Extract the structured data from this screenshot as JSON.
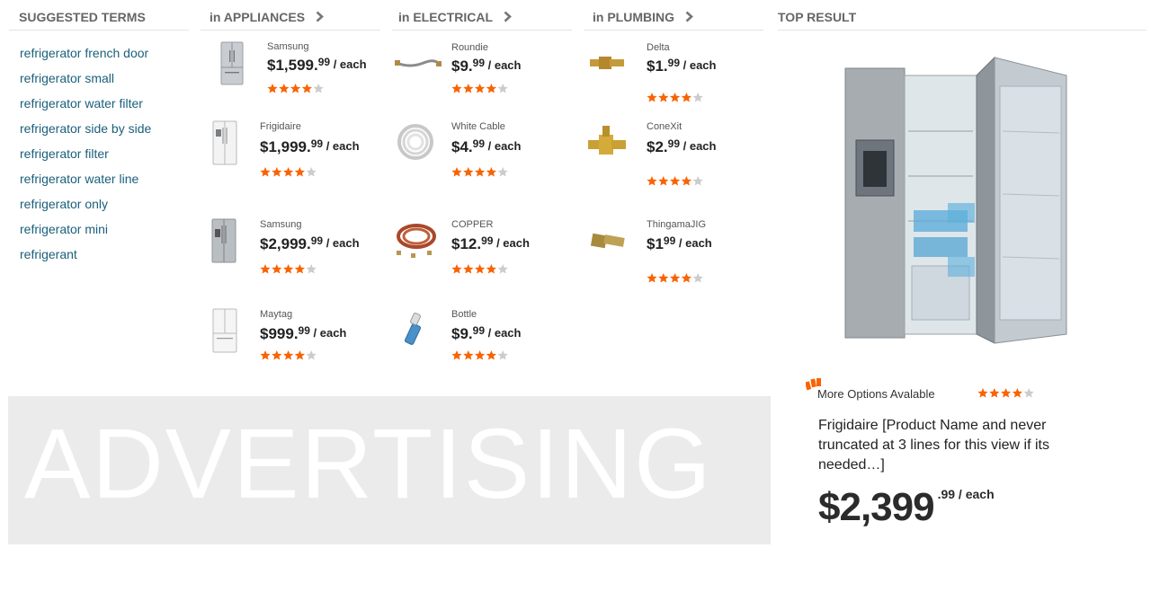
{
  "suggested": {
    "header": "SUGGESTED TERMS",
    "terms": [
      "refrigerator french door",
      "refrigerator small",
      "refrigerator water filter",
      "refrigerator side by side",
      "refrigerator filter",
      "refrigerator water line",
      "refrigerator only",
      "refrigerator mini",
      "refrigerant"
    ]
  },
  "appliances": {
    "header": "in APPLIANCES",
    "products": [
      {
        "brand": "Samsung",
        "dollars": "$1,599.",
        "cents": "99",
        "each": " / each",
        "rating": 4
      },
      {
        "brand": "Frigidaire",
        "dollars": "$1,999.",
        "cents": "99",
        "each": " / each",
        "rating": 4
      },
      {
        "brand": "Samsung",
        "dollars": "$2,999.",
        "cents": "99",
        "each": " / each",
        "rating": 4
      },
      {
        "brand": "Maytag",
        "dollars": "$999.",
        "cents": "99",
        "each": " / each",
        "rating": 4
      }
    ]
  },
  "electrical": {
    "header": "in ELECTRICAL",
    "products": [
      {
        "brand": "Roundie",
        "dollars": "$9.",
        "cents": "99",
        "each": " / each",
        "rating": 4
      },
      {
        "brand": "White Cable",
        "dollars": "$4.",
        "cents": "99",
        "each": " / each",
        "rating": 4
      },
      {
        "brand": "COPPER",
        "dollars": "$12.",
        "cents": "99",
        "each": " / each",
        "rating": 4
      },
      {
        "brand": "Bottle",
        "dollars": "$9.",
        "cents": "99",
        "each": " / each",
        "rating": 4
      }
    ]
  },
  "plumbing": {
    "header": "in PLUMBING",
    "products": [
      {
        "brand": "Delta",
        "dollars": "$1.",
        "cents": "99",
        "each": " / each",
        "rating": 4
      },
      {
        "brand": "ConeXit",
        "dollars": "$2.",
        "cents": "99",
        "each": " / each",
        "rating": 4
      },
      {
        "brand": "ThingamaJIG",
        "dollars": "$1",
        "cents": "99",
        "each": " / each",
        "rating": 4
      }
    ]
  },
  "advertising": {
    "text": "ADVERTISING"
  },
  "top_result": {
    "header": "TOP RESULT",
    "more_options": "More Options Avalable",
    "rating": 4,
    "name": "Frigidaire [Product Name and never truncated at 3 lines for this view if its needed…]",
    "price_dollars": "$2,399",
    "price_cents": ".99 / each"
  },
  "colors": {
    "link": "#1a5f7a",
    "star_on": "#f96302",
    "star_off": "#cccccc",
    "header_text": "#666666",
    "ad_bg": "#ebebeb"
  },
  "icons": {
    "category_arrow": "chevron-right-icon",
    "more_options": "color-swatch-icon",
    "star": "star-icon"
  }
}
